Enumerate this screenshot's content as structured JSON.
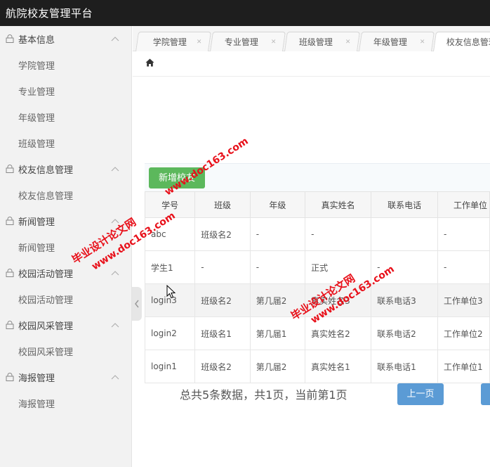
{
  "app": {
    "title": "航院校友管理平台"
  },
  "sidebar": {
    "groups": [
      {
        "label": "基本信息",
        "items": [
          "学院管理",
          "专业管理",
          "年级管理",
          "班级管理"
        ]
      },
      {
        "label": "校友信息管理",
        "items": [
          "校友信息管理"
        ]
      },
      {
        "label": "新闻管理",
        "items": [
          "新闻管理"
        ]
      },
      {
        "label": "校园活动管理",
        "items": [
          "校园活动管理"
        ]
      },
      {
        "label": "校园风采管理",
        "items": [
          "校园风采管理"
        ]
      },
      {
        "label": "海报管理",
        "items": [
          "海报管理"
        ]
      }
    ]
  },
  "tabs": [
    {
      "label": "学院管理"
    },
    {
      "label": "专业管理"
    },
    {
      "label": "班级管理"
    },
    {
      "label": "年级管理"
    },
    {
      "label": "校友信息管理",
      "active": true
    }
  ],
  "toolbar": {
    "add_label": "新增校友"
  },
  "table": {
    "headers": [
      "学号",
      "班级",
      "年级",
      "真实姓名",
      "联系电话",
      "工作单位"
    ],
    "rows": [
      [
        "abc",
        "班级名2",
        "-",
        "-",
        "",
        "-"
      ],
      [
        "学生1",
        "-",
        "-",
        "正式",
        "-",
        "-"
      ],
      [
        "login3",
        "班级名2",
        "第几届2",
        "真实姓名3",
        "联系电话3",
        "工作单位3"
      ],
      [
        "login2",
        "班级名1",
        "第几届1",
        "真实姓名2",
        "联系电话2",
        "工作单位2"
      ],
      [
        "login1",
        "班级名2",
        "第几届2",
        "真实姓名1",
        "联系电话1",
        "工作单位1"
      ]
    ]
  },
  "pagination": {
    "summary": "总共5条数据，共1页，当前第1页",
    "prev_label": "上一页"
  },
  "watermarks": [
    "www.doc163.com",
    "毕业设计论文网",
    "www.doc163.com",
    "毕业设计论文网",
    "www.doc163.com"
  ],
  "icons": {
    "group": "lock-icon",
    "chevron": "chevron-up-icon",
    "home": "home-icon",
    "collapse": "chevron-left-icon",
    "tab_close": "close-icon"
  }
}
